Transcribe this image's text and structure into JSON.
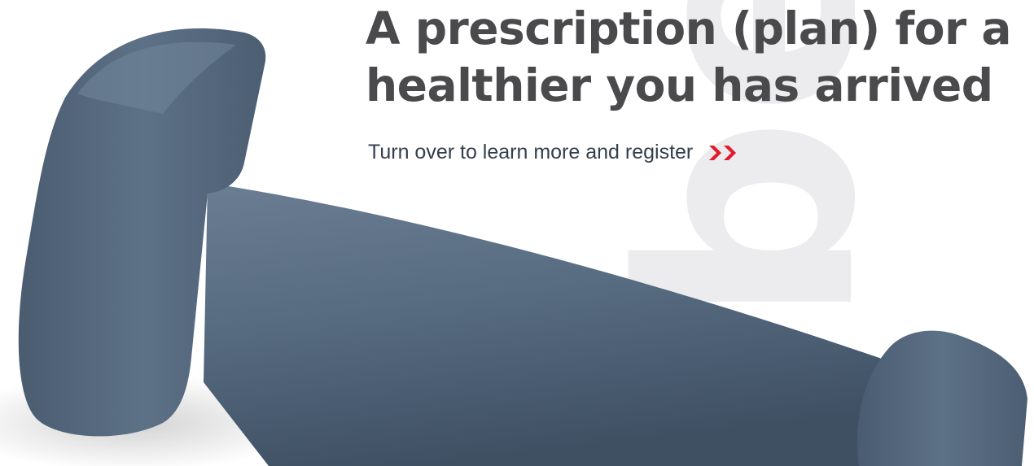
{
  "headline": {
    "line1": "A prescription (plan) for a",
    "line2": "healthier you has arrived"
  },
  "cta": {
    "label": "Turn over to learn more and register",
    "icon": "double-chevron-right-icon"
  },
  "watermark": {
    "letters": "be"
  },
  "colors": {
    "background": "#ffffff",
    "headline": "#4a4a4c",
    "cta_text": "#333f4c",
    "accent": "#e31b2d",
    "watermark": "#ececee",
    "dumbbell": "#566a80"
  }
}
